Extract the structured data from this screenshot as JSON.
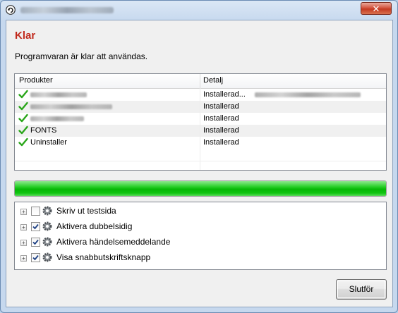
{
  "window": {
    "close_label": "✕"
  },
  "heading": "Klar",
  "subtitle": "Programvaran är klar att användas.",
  "products": {
    "columns": [
      "Produkter",
      "Detalj"
    ],
    "rows": [
      {
        "name": "",
        "name_obscured": true,
        "detail": "Installerad...",
        "detail_has_obscured_suffix": true
      },
      {
        "name": "",
        "name_obscured": true,
        "detail": "Installerad"
      },
      {
        "name": "",
        "name_obscured": true,
        "detail": "Installerad"
      },
      {
        "name": "FONTS",
        "detail": "Installerad"
      },
      {
        "name": "Uninstaller",
        "detail": "Installerad"
      }
    ]
  },
  "progress": {
    "fraction": 1.0,
    "color": "#11c411"
  },
  "options": [
    {
      "label": "Skriv ut testsida",
      "checked": false,
      "icon": "gear-icon"
    },
    {
      "label": "Aktivera dubbelsidig",
      "checked": true,
      "icon": "gear-icon"
    },
    {
      "label": "Aktivera händelsemeddelande",
      "checked": true,
      "icon": "gear-icon"
    },
    {
      "label": "Visa snabbutskriftsknapp",
      "checked": true,
      "icon": "gear-icon"
    }
  ],
  "buttons": {
    "finish": "Slutför"
  },
  "colors": {
    "heading": "#c12a1d",
    "check": "#2aa61a",
    "close": "#c43a22"
  }
}
